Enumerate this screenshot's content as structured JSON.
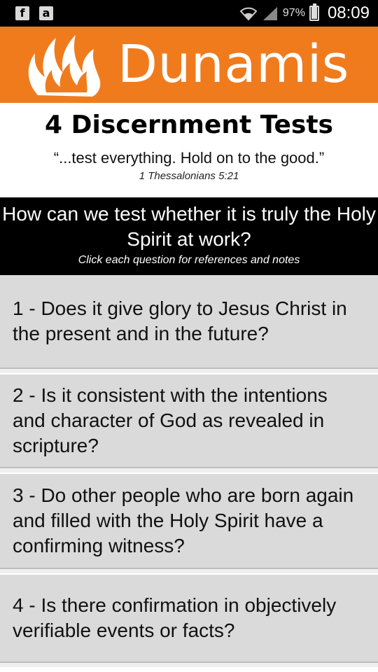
{
  "status_bar": {
    "left_icons": [
      {
        "name": "facebook-icon",
        "glyph": "f"
      },
      {
        "name": "amazon-icon",
        "glyph": "a"
      }
    ],
    "battery_text": "97%",
    "battery_level": 0.97,
    "time": "08:09"
  },
  "banner": {
    "brand": "Dunamis",
    "color": "#f07b1d",
    "logo_icon": "flame-icon"
  },
  "heading": {
    "title": "4 Discernment Tests",
    "quote": "“...test everything. Hold on to the good.”",
    "reference": "1 Thessalonians 5:21"
  },
  "prompt": {
    "question": "How can we test whether it is truly the Holy Spirit at work?",
    "hint": "Click each question for references and notes"
  },
  "questions": [
    {
      "label": "1 - Does it give glory to Jesus Christ in the present and in the future?"
    },
    {
      "label": "2 - Is it consistent with the intentions and character of God as revealed in scripture?"
    },
    {
      "label": "3 - Do other people who are born again and filled with the Holy Spirit have a confirming witness?"
    },
    {
      "label": "4 - Is there confirmation in objectively verifiable events or facts?"
    }
  ]
}
